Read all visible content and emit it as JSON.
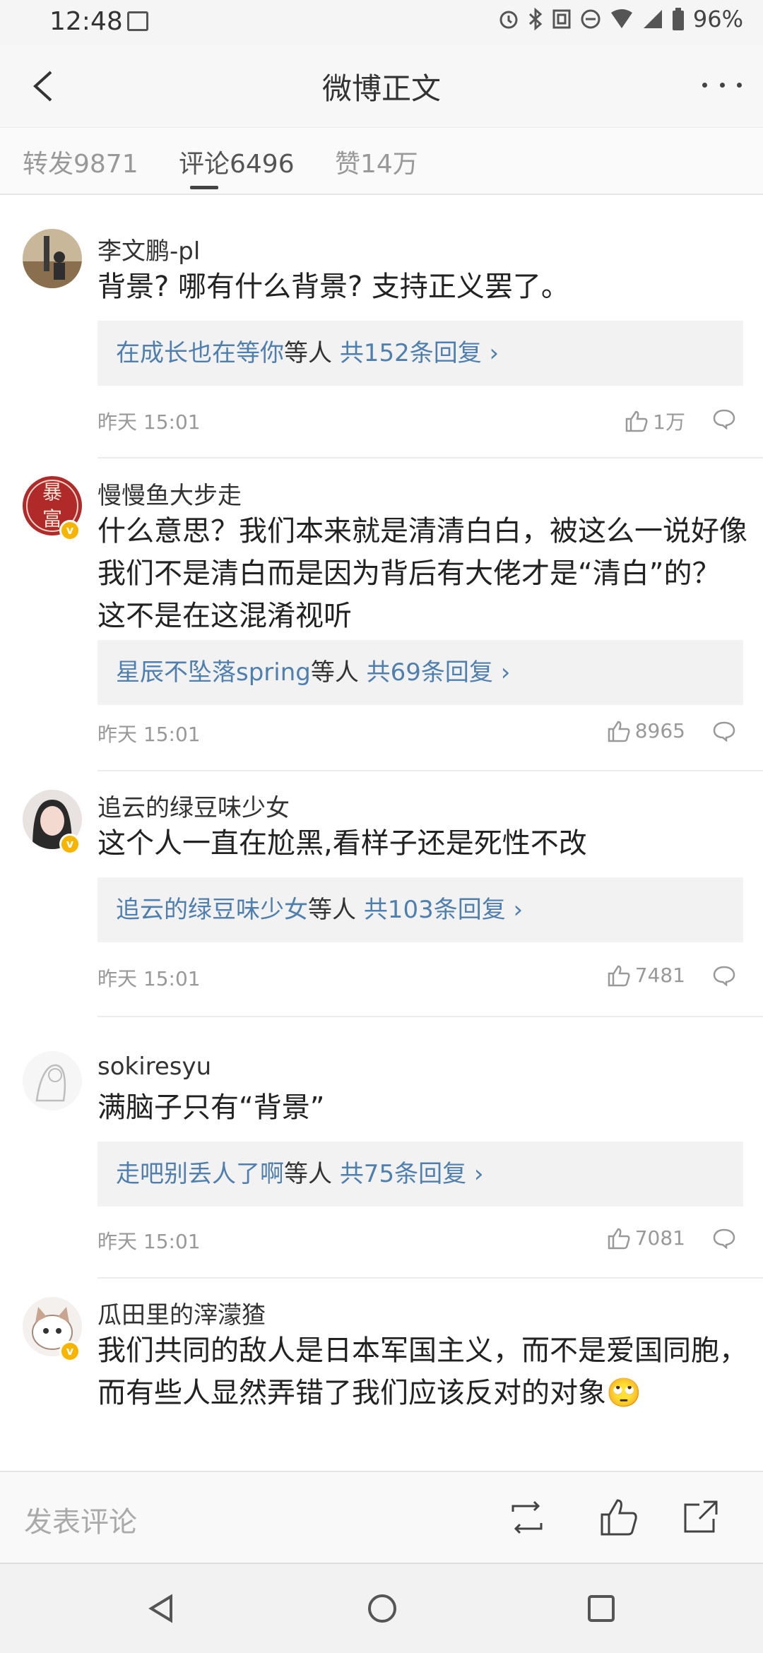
{
  "status_bar": {
    "time": "12:48",
    "battery": "96%"
  },
  "nav": {
    "title": "微博正文"
  },
  "tabs": [
    {
      "label": "转发9871"
    },
    {
      "label": "评论6496"
    },
    {
      "label": "赞14万"
    }
  ],
  "comments": [
    {
      "username": "李文鹏-pl",
      "verified": false,
      "content": "背景? 哪有什么背景? 支持正义罢了。",
      "reply_name": "在成长也在等你",
      "reply_mid": "等人 ",
      "reply_count": "共152条回复",
      "time": "昨天 15:01",
      "likes": "1万"
    },
    {
      "username": "慢慢鱼大步走",
      "verified": true,
      "avatar_text": "暴富",
      "content": "什么意思？我们本来就是清清白白，被这么一说好像我们不是清白而是因为背后有大佬才是“清白”的？这不是在这混淆视听",
      "reply_name": "星辰不坠落spring",
      "reply_mid": "等人 ",
      "reply_count": "共69条回复",
      "time": "昨天 15:01",
      "likes": "8965"
    },
    {
      "username": "追云的绿豆味少女",
      "verified": true,
      "content": "这个人一直在尬黑,看样子还是死性不改",
      "reply_name": "追云的绿豆味少女",
      "reply_mid": "等人 ",
      "reply_count": "共103条回复",
      "time": "昨天 15:01",
      "likes": "7481"
    },
    {
      "username": "sokiresyu",
      "verified": false,
      "content": "满脑子只有“背景”",
      "reply_name": "走吧别丢人了啊",
      "reply_mid": "等人 ",
      "reply_count": "共75条回复",
      "time": "昨天 15:01",
      "likes": "7081"
    },
    {
      "username": "瓜田里的滓濛猹",
      "verified": true,
      "content": "我们共同的敌人是日本军国主义，而不是爱国同胞，而有些人显然弄错了我们应该反对的对象🙄"
    }
  ],
  "bottom_bar": {
    "comment_placeholder": "发表评论"
  },
  "colors": {
    "link": "#4f7fae",
    "badge": "#f7b500"
  }
}
